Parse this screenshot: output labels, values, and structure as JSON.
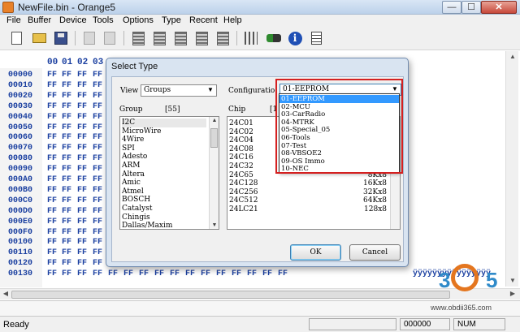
{
  "window": {
    "title": "NewFile.bin - Orange5",
    "min_glyph": "—",
    "max_glyph": "☐",
    "close_glyph": "✕"
  },
  "menu": [
    "File",
    "Buffer",
    "Device",
    "Tools",
    "Options",
    "Type",
    "Recent",
    "Help"
  ],
  "toolbar": {
    "icons": [
      "new-file-icon",
      "open-folder-icon",
      "save-icon",
      "copy-icon",
      "paste-icon",
      "read-chip-icon",
      "write-chip-icon",
      "verify-chip-icon",
      "erase-chip-icon",
      "blank-check-icon",
      "settings-sliders-icon",
      "tool-adapter-icon",
      "info-icon",
      "report-document-icon"
    ],
    "info_glyph": "i"
  },
  "hex": {
    "columns_visible": [
      "00",
      "01",
      "02",
      "03"
    ],
    "rows": [
      {
        "addr": "00000",
        "bytes": [
          "FF",
          "FF",
          "FF",
          "FF"
        ]
      },
      {
        "addr": "00010",
        "bytes": [
          "FF",
          "FF",
          "FF",
          "FF"
        ]
      },
      {
        "addr": "00020",
        "bytes": [
          "FF",
          "FF",
          "FF",
          "FF"
        ]
      },
      {
        "addr": "00030",
        "bytes": [
          "FF",
          "FF",
          "FF",
          "FF"
        ]
      },
      {
        "addr": "00040",
        "bytes": [
          "FF",
          "FF",
          "FF",
          "FF"
        ]
      },
      {
        "addr": "00050",
        "bytes": [
          "FF",
          "FF",
          "FF",
          "FF"
        ]
      },
      {
        "addr": "00060",
        "bytes": [
          "FF",
          "FF",
          "FF",
          "FF"
        ]
      },
      {
        "addr": "00070",
        "bytes": [
          "FF",
          "FF",
          "FF",
          "FF"
        ]
      },
      {
        "addr": "00080",
        "bytes": [
          "FF",
          "FF",
          "FF",
          "FF"
        ]
      },
      {
        "addr": "00090",
        "bytes": [
          "FF",
          "FF",
          "FF",
          "FF"
        ]
      },
      {
        "addr": "000A0",
        "bytes": [
          "FF",
          "FF",
          "FF",
          "FF"
        ]
      },
      {
        "addr": "000B0",
        "bytes": [
          "FF",
          "FF",
          "FF",
          "FF"
        ]
      },
      {
        "addr": "000C0",
        "bytes": [
          "FF",
          "FF",
          "FF",
          "FF"
        ]
      },
      {
        "addr": "000D0",
        "bytes": [
          "FF",
          "FF",
          "FF",
          "FF"
        ]
      },
      {
        "addr": "000E0",
        "bytes": [
          "FF",
          "FF",
          "FF",
          "FF"
        ]
      },
      {
        "addr": "000F0",
        "bytes": [
          "FF",
          "FF",
          "FF",
          "FF"
        ]
      },
      {
        "addr": "00100",
        "bytes": [
          "FF",
          "FF",
          "FF",
          "FF"
        ]
      },
      {
        "addr": "00110",
        "bytes": [
          "FF",
          "FF",
          "FF",
          "FF"
        ]
      },
      {
        "addr": "00120",
        "bytes": [
          "FF",
          "FF",
          "FF",
          "FF"
        ]
      },
      {
        "addr": "00130",
        "bytes": [
          "FF",
          "FF",
          "FF",
          "FF",
          "FF",
          "FF",
          "FF",
          "FF",
          "FF",
          "FF",
          "FF",
          "FF",
          "FF",
          "FF",
          "FF",
          "FF"
        ],
        "ascii": "ÿÿÿÿÿÿÿÿÿÿÿÿÿÿÿÿ"
      }
    ]
  },
  "dialog": {
    "title": "Select Type",
    "view_label": "View",
    "view_value": "Groups",
    "config_label": "Configuratio",
    "config_value": "01-EEPROM",
    "group_header": "Group",
    "group_count": "[55]",
    "chip_header": "Chip",
    "chip_count": "[1",
    "groups": [
      "I2C",
      "MicroWire",
      "4Wire",
      "SPI",
      "Adesto",
      "ARM",
      "Altera",
      "Amic",
      "Atmel",
      "BOSCH",
      "Catalyst",
      "Chingis",
      "Dallas/Maxim"
    ],
    "chips": [
      {
        "name": "24C01",
        "size": ""
      },
      {
        "name": "24C02",
        "size": ""
      },
      {
        "name": "24C04",
        "size": ""
      },
      {
        "name": "24C08",
        "size": ""
      },
      {
        "name": "24C16",
        "size": ""
      },
      {
        "name": "24C32",
        "size": ""
      },
      {
        "name": "24C65",
        "size": "8Kx8"
      },
      {
        "name": "24C128",
        "size": "16Kx8"
      },
      {
        "name": "24C256",
        "size": "32Kx8"
      },
      {
        "name": "24C512",
        "size": "64Kx8"
      },
      {
        "name": "24LC21",
        "size": "128x8"
      }
    ],
    "ok_label": "OK",
    "cancel_label": "Cancel"
  },
  "config_dropdown": {
    "options": [
      "01-EEPROM",
      "02-MCU",
      "03-CarRadio",
      "04-MTRK",
      "05-Special_05",
      "06-Tools",
      "07-Test",
      "08-VBSOE2",
      "09-OS Immo",
      "10-NEC"
    ],
    "selected": "01-EEPROM",
    "highlight_color": "#d42020"
  },
  "status": {
    "text": "Ready",
    "offset": "000000",
    "mode": "NUM"
  },
  "watermark": {
    "logo_left": "3",
    "logo_right": "5",
    "url": "www.obdii365.com"
  },
  "colors": {
    "hex_text": "#1a3fa0",
    "selection": "#3399ff"
  }
}
